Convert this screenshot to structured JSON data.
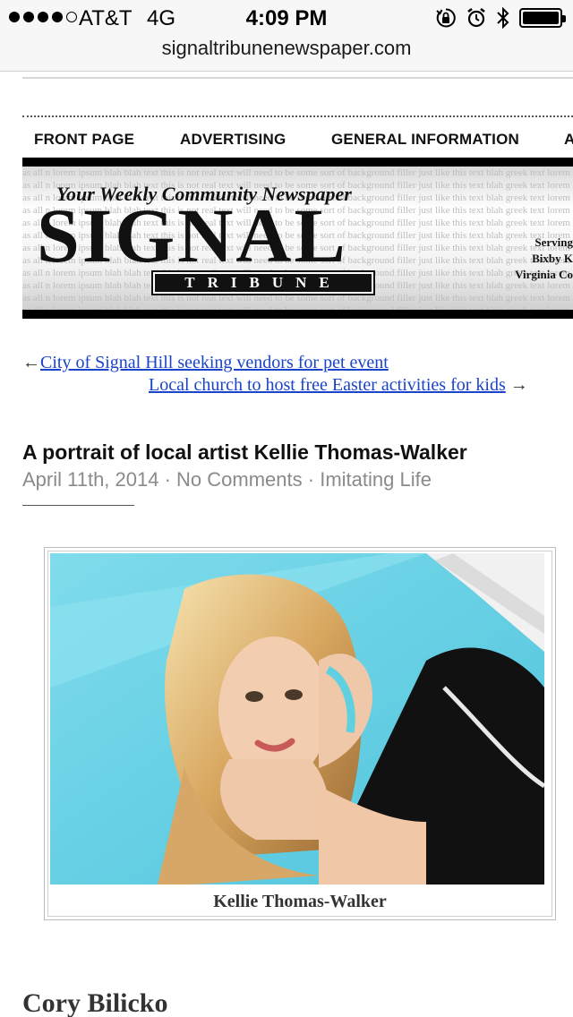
{
  "status_bar": {
    "carrier": "AT&T",
    "network": "4G",
    "time": "4:09 PM",
    "signal_bars": 4,
    "signal_max": 5,
    "icons": [
      "orientation-lock-icon",
      "alarm-icon",
      "bluetooth-icon",
      "battery-icon"
    ]
  },
  "browser": {
    "url": "signaltribunenewspaper.com"
  },
  "nav": {
    "items": [
      "FRONT PAGE",
      "ADVERTISING",
      "GENERAL INFORMATION",
      "A"
    ]
  },
  "masthead": {
    "tagline": "Your Weekly Community Newspaper",
    "name": "SIGNAL",
    "subname": "TRIBUNE",
    "serving_lines": [
      "Serving",
      "Bixby K",
      "Virginia Co"
    ],
    "background_text": "as all n lorem ipsum blah blah text this is not real text will need to be some sort of background filler just like this text blah greek text lorem ipsum not readable will need to be some sort"
  },
  "post_nav": {
    "prev_arrow": "←",
    "prev_label": "City of Signal Hill seeking vendors for pet event",
    "next_label": "Local church to host free Easter activities for kids",
    "next_arrow": "→"
  },
  "article": {
    "title": "A portrait of local artist Kellie Thomas-Walker",
    "date": "April 11th, 2014",
    "comments": "No Comments",
    "category": "Imitating Life",
    "separator": " · ",
    "image_caption": "Kellie Thomas-Walker",
    "author": "Cory Bilicko"
  },
  "colors": {
    "link": "#1a44c9",
    "meta": "#8a8a8a",
    "photo_background": "#6fd3e6"
  }
}
